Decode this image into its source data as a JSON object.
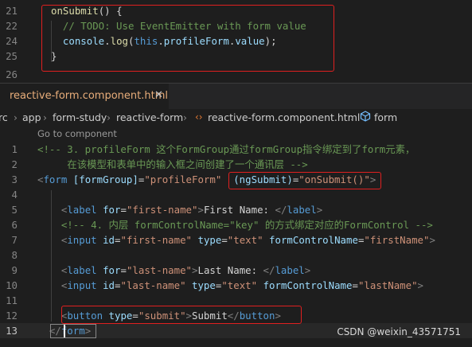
{
  "top_pane": {
    "lines": [
      {
        "num": "21",
        "parts": [
          {
            "t": "onSubmit",
            "c": "c-fn"
          },
          {
            "t": "() {",
            "c": "c-txt"
          }
        ]
      },
      {
        "num": "22",
        "parts": [
          {
            "t": "  // TODO: Use EventEmitter with form value",
            "c": "c-com"
          }
        ]
      },
      {
        "num": "24",
        "parts": [
          {
            "t": "  console",
            "c": "c-var"
          },
          {
            "t": ".",
            "c": "c-txt"
          },
          {
            "t": "log",
            "c": "c-fn"
          },
          {
            "t": "(",
            "c": "c-txt"
          },
          {
            "t": "this",
            "c": "c-kw"
          },
          {
            "t": ".",
            "c": "c-txt"
          },
          {
            "t": "profileForm",
            "c": "c-var"
          },
          {
            "t": ".",
            "c": "c-txt"
          },
          {
            "t": "value",
            "c": "c-var"
          },
          {
            "t": ");",
            "c": "c-txt"
          }
        ]
      },
      {
        "num": "25",
        "parts": [
          {
            "t": "}",
            "c": "c-txt"
          }
        ]
      },
      {
        "num": "26",
        "parts": []
      }
    ]
  },
  "tab": {
    "label": "reactive-form.component.html",
    "close": "✕"
  },
  "breadcrumb": {
    "items": [
      "rc",
      "app",
      "form-study",
      "reactive-form",
      "reactive-form.component.html",
      "form"
    ],
    "separator": "›"
  },
  "code_lens": "Go to component",
  "bottom_pane": {
    "lines": [
      {
        "num": "1",
        "parts": [
          {
            "t": "<!-- 3. profileForm 这个FormGroup通过formGroup指令绑定到了form元素，",
            "c": "c-com"
          }
        ]
      },
      {
        "num": "2",
        "parts": [
          {
            "t": "     在该模型和表单中的输入框之间创建了一个通讯层 -->",
            "c": "c-com"
          }
        ]
      },
      {
        "num": "3",
        "parts": [
          {
            "t": "<",
            "c": "c-tagbr"
          },
          {
            "t": "form",
            "c": "c-kw"
          },
          {
            "t": " ",
            "c": "c-txt"
          },
          {
            "t": "[formGroup]",
            "c": "c-var"
          },
          {
            "t": "=",
            "c": "c-txt"
          },
          {
            "t": "\"profileForm\"",
            "c": "c-str"
          },
          {
            "t": "  ",
            "c": "c-txt"
          },
          {
            "t": "(ngSubmit)",
            "c": "c-var"
          },
          {
            "t": "=",
            "c": "c-txt"
          },
          {
            "t": "\"onSubmit()\"",
            "c": "c-str"
          },
          {
            "t": ">",
            "c": "c-tagbr"
          }
        ]
      },
      {
        "num": "4",
        "parts": []
      },
      {
        "num": "5",
        "parts": [
          {
            "t": "    <",
            "c": "c-tagbr"
          },
          {
            "t": "label",
            "c": "c-kw"
          },
          {
            "t": " ",
            "c": "c-txt"
          },
          {
            "t": "for",
            "c": "c-var"
          },
          {
            "t": "=",
            "c": "c-txt"
          },
          {
            "t": "\"first-name\"",
            "c": "c-str"
          },
          {
            "t": ">",
            "c": "c-tagbr"
          },
          {
            "t": "First Name: ",
            "c": "c-txt"
          },
          {
            "t": "</",
            "c": "c-tagbr"
          },
          {
            "t": "label",
            "c": "c-kw"
          },
          {
            "t": ">",
            "c": "c-tagbr"
          }
        ]
      },
      {
        "num": "6",
        "parts": [
          {
            "t": "    <!-- 4. 内层 formControlName=\"key\" 的方式绑定对应的FormControl -->",
            "c": "c-com"
          }
        ]
      },
      {
        "num": "7",
        "parts": [
          {
            "t": "    <",
            "c": "c-tagbr"
          },
          {
            "t": "input",
            "c": "c-kw"
          },
          {
            "t": " ",
            "c": "c-txt"
          },
          {
            "t": "id",
            "c": "c-var"
          },
          {
            "t": "=",
            "c": "c-txt"
          },
          {
            "t": "\"first-name\"",
            "c": "c-str"
          },
          {
            "t": " ",
            "c": "c-txt"
          },
          {
            "t": "type",
            "c": "c-var"
          },
          {
            "t": "=",
            "c": "c-txt"
          },
          {
            "t": "\"text\"",
            "c": "c-str"
          },
          {
            "t": " ",
            "c": "c-txt"
          },
          {
            "t": "formControlName",
            "c": "c-var"
          },
          {
            "t": "=",
            "c": "c-txt"
          },
          {
            "t": "\"firstName\"",
            "c": "c-str"
          },
          {
            "t": ">",
            "c": "c-tagbr"
          }
        ]
      },
      {
        "num": "8",
        "parts": []
      },
      {
        "num": "9",
        "parts": [
          {
            "t": "    <",
            "c": "c-tagbr"
          },
          {
            "t": "label",
            "c": "c-kw"
          },
          {
            "t": " ",
            "c": "c-txt"
          },
          {
            "t": "for",
            "c": "c-var"
          },
          {
            "t": "=",
            "c": "c-txt"
          },
          {
            "t": "\"last-name\"",
            "c": "c-str"
          },
          {
            "t": ">",
            "c": "c-tagbr"
          },
          {
            "t": "Last Name: ",
            "c": "c-txt"
          },
          {
            "t": "</",
            "c": "c-tagbr"
          },
          {
            "t": "label",
            "c": "c-kw"
          },
          {
            "t": ">",
            "c": "c-tagbr"
          }
        ]
      },
      {
        "num": "10",
        "parts": [
          {
            "t": "    <",
            "c": "c-tagbr"
          },
          {
            "t": "input",
            "c": "c-kw"
          },
          {
            "t": " ",
            "c": "c-txt"
          },
          {
            "t": "id",
            "c": "c-var"
          },
          {
            "t": "=",
            "c": "c-txt"
          },
          {
            "t": "\"last-name\"",
            "c": "c-str"
          },
          {
            "t": " ",
            "c": "c-txt"
          },
          {
            "t": "type",
            "c": "c-var"
          },
          {
            "t": "=",
            "c": "c-txt"
          },
          {
            "t": "\"text\"",
            "c": "c-str"
          },
          {
            "t": " ",
            "c": "c-txt"
          },
          {
            "t": "formControlName",
            "c": "c-var"
          },
          {
            "t": "=",
            "c": "c-txt"
          },
          {
            "t": "\"lastName\"",
            "c": "c-str"
          },
          {
            "t": ">",
            "c": "c-tagbr"
          }
        ]
      },
      {
        "num": "11",
        "parts": []
      },
      {
        "num": "12",
        "parts": [
          {
            "t": "    <",
            "c": "c-tagbr"
          },
          {
            "t": "button",
            "c": "c-kw"
          },
          {
            "t": " ",
            "c": "c-txt"
          },
          {
            "t": "type",
            "c": "c-var"
          },
          {
            "t": "=",
            "c": "c-txt"
          },
          {
            "t": "\"submit\"",
            "c": "c-str"
          },
          {
            "t": ">",
            "c": "c-tagbr"
          },
          {
            "t": "Submit",
            "c": "c-txt"
          },
          {
            "t": "</",
            "c": "c-tagbr"
          },
          {
            "t": "button",
            "c": "c-kw"
          },
          {
            "t": ">",
            "c": "c-tagbr"
          }
        ]
      },
      {
        "num": "13",
        "parts": [
          {
            "t": "  </",
            "c": "c-tagbr"
          },
          {
            "t": "form",
            "c": "c-kw"
          },
          {
            "t": ">",
            "c": "c-tagbr"
          }
        ]
      }
    ]
  },
  "watermark": "CSDN @weixin_43571751",
  "colors": {
    "background": "#1e1e1e",
    "highlight_box": "#e02020",
    "tab_text": "#e8ad7a"
  }
}
